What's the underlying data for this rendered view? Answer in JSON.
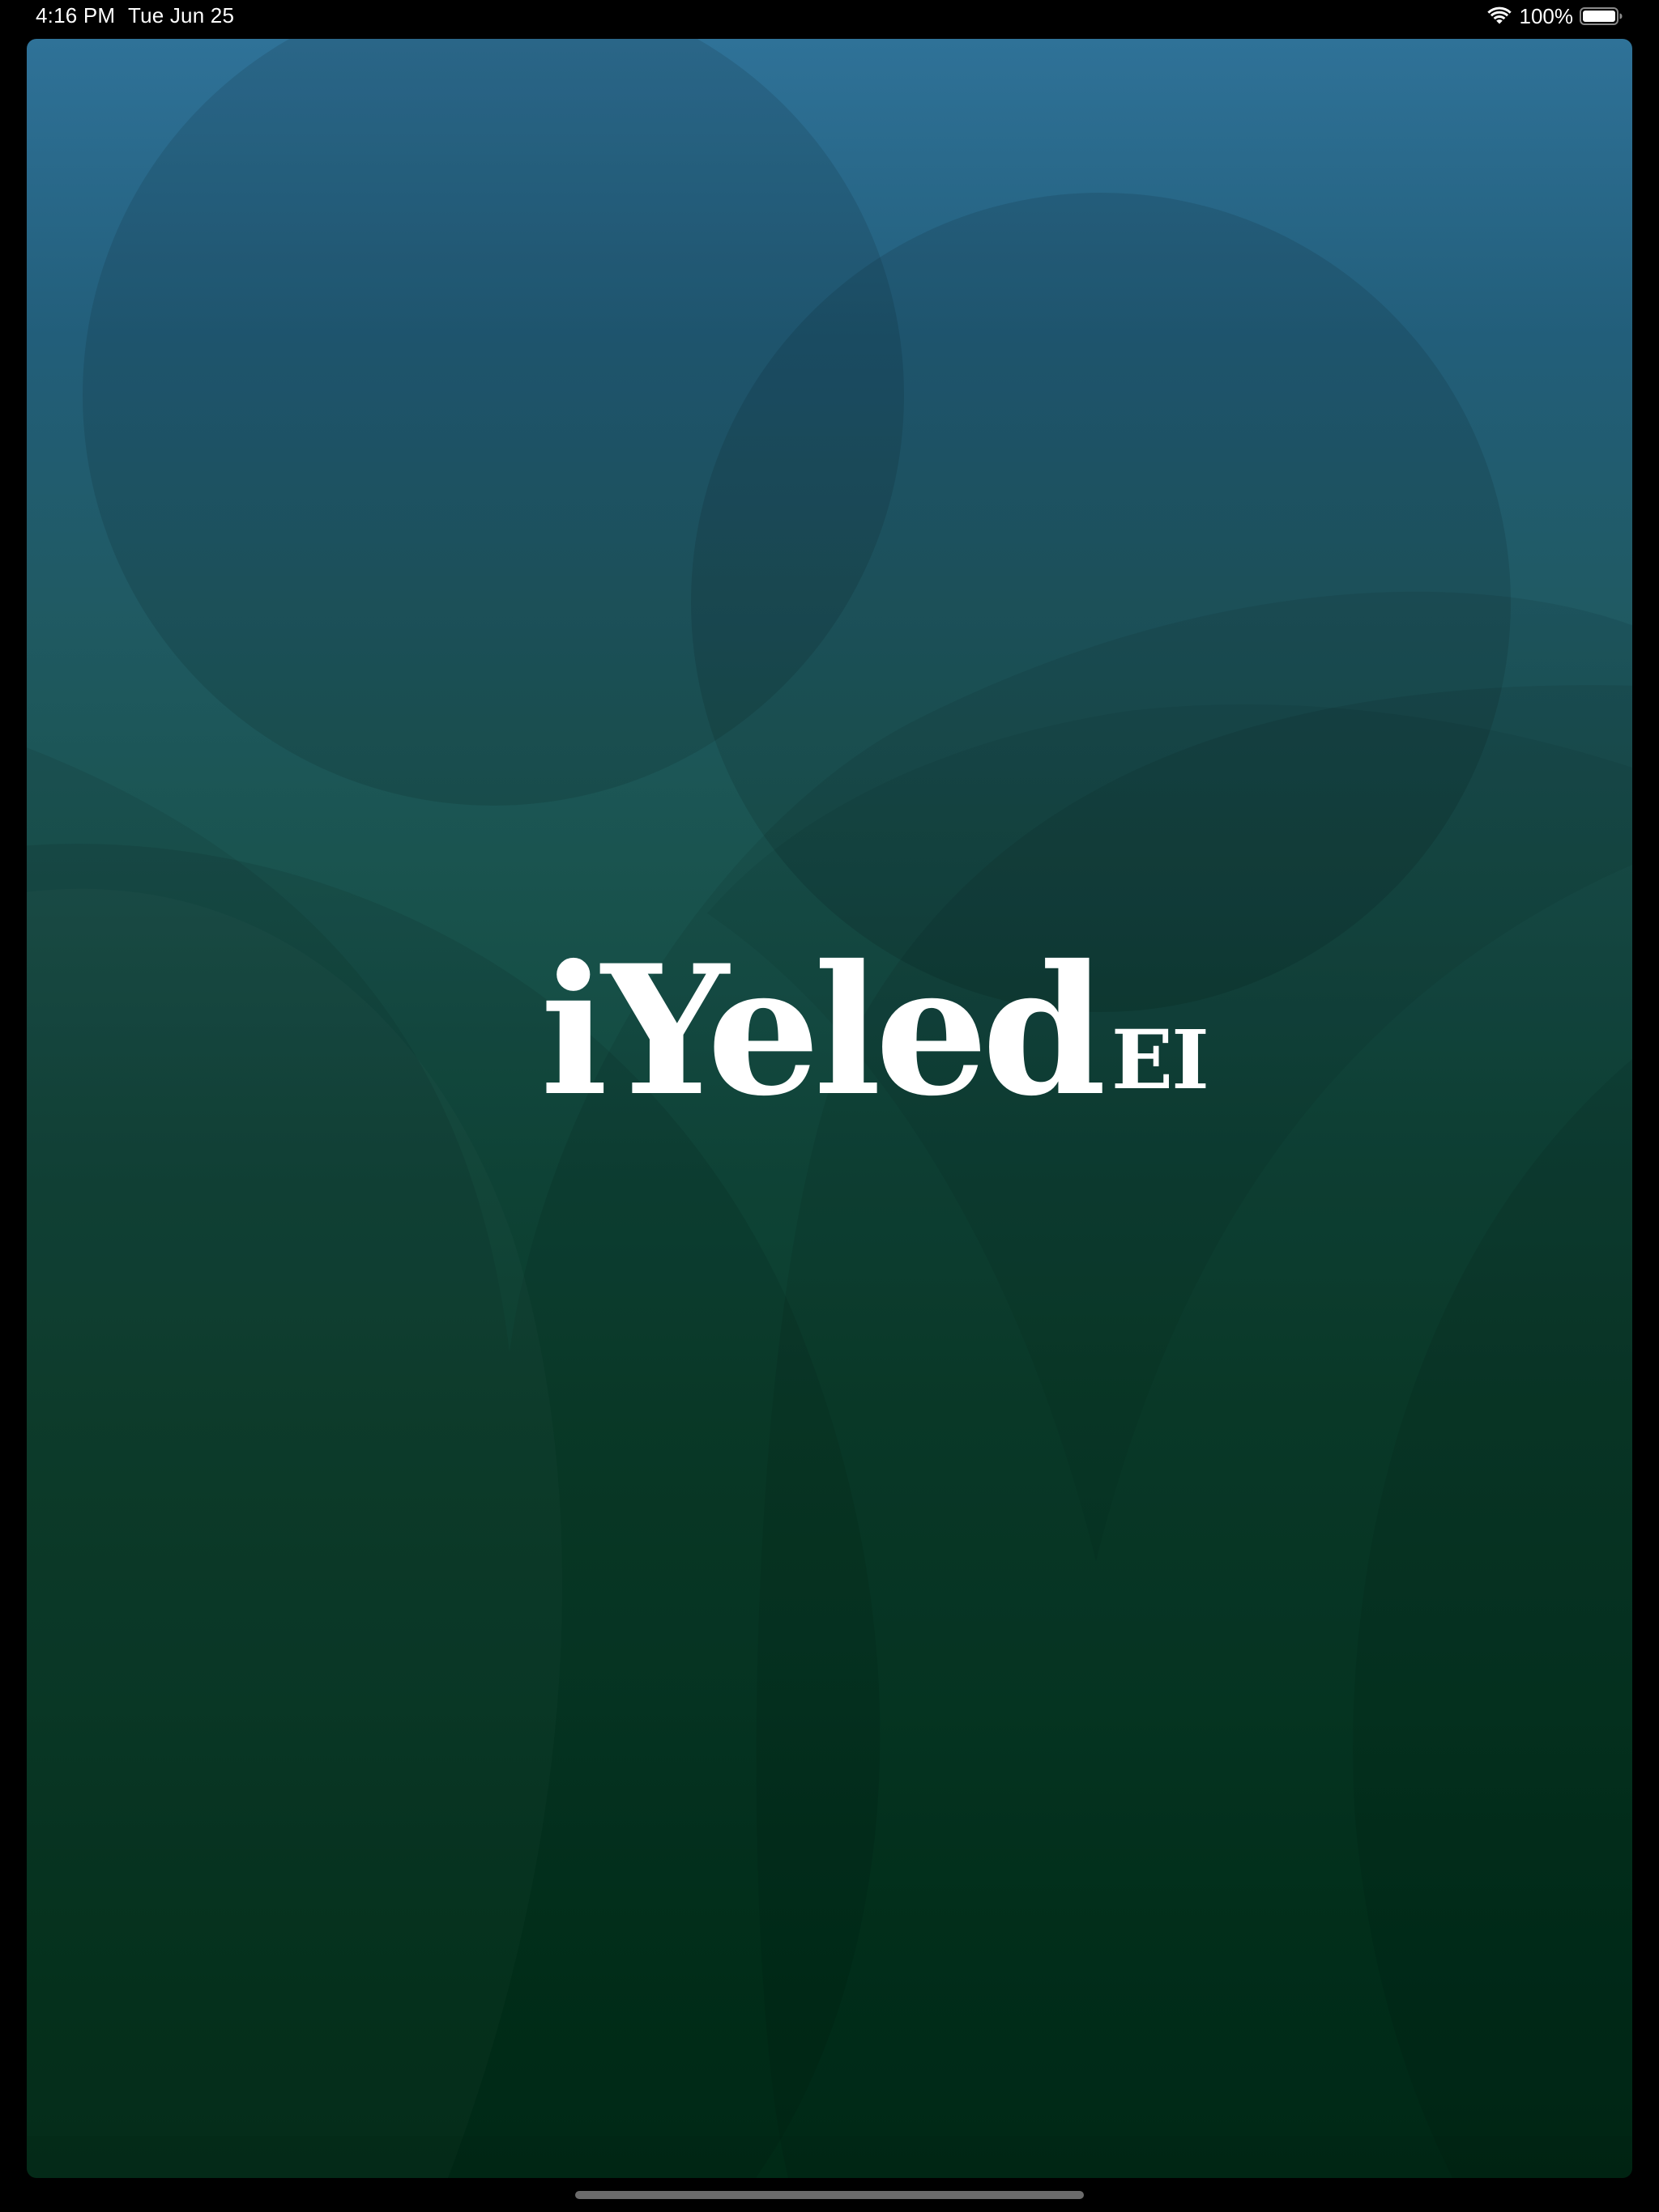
{
  "status_bar": {
    "time": "4:16 PM",
    "date": "Tue Jun 25",
    "battery_percent": "100%",
    "wifi_icon": "wifi-icon",
    "battery_icon": "battery-icon"
  },
  "app": {
    "logo_text": "iYeled",
    "logo_suffix": "EI",
    "gradient_top": "#2f7298",
    "gradient_bottom": "#013019"
  }
}
